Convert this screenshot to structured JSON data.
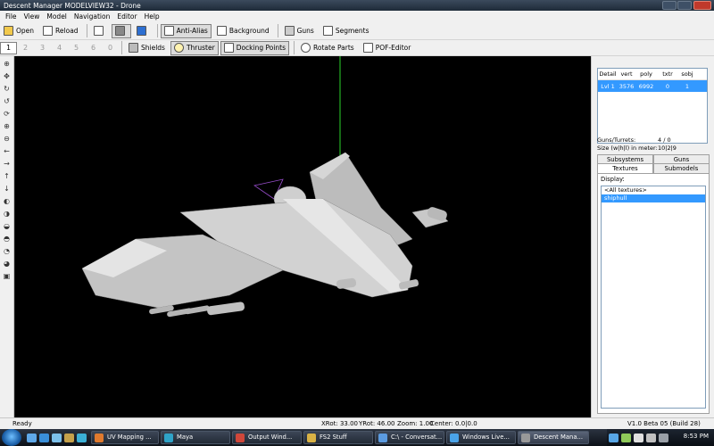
{
  "window": {
    "title": "Descent Manager MODELVIEW32 - Drone"
  },
  "menu": [
    "File",
    "View",
    "Model",
    "Navigation",
    "Editor",
    "Help"
  ],
  "toolbar1": {
    "open": "Open",
    "reload": "Reload",
    "anti_alias": "Anti-Alias",
    "background": "Background",
    "guns": "Guns",
    "segments": "Segments"
  },
  "toolbar2": {
    "numbers": [
      "1",
      "2",
      "3",
      "4",
      "5",
      "6",
      "0"
    ],
    "shields": "Shields",
    "thruster": "Thruster",
    "docking_points": "Docking Points",
    "rotate_parts": "Rotate Parts",
    "pof_editor": "POF-Editor"
  },
  "lod_table": {
    "headers": [
      "Detail",
      "vert",
      "poly",
      "txtr",
      "sobj"
    ],
    "rows": [
      [
        "Lvl 1",
        "3576",
        "6992",
        "0",
        "1"
      ]
    ]
  },
  "info": {
    "guns_turrets_label": "Guns/Turrets:",
    "guns_turrets_value": "4 / 0",
    "size_label": "Size (w|h|l) in meter:",
    "size_value": "10|2|9"
  },
  "tabs": {
    "subsystems": "Subsystems",
    "guns": "Guns",
    "textures": "Textures",
    "submodels": "Submodels"
  },
  "textures_panel": {
    "display_label": "Display:",
    "items": [
      "<All textures>",
      "shiphull"
    ]
  },
  "status": {
    "ready": "Ready",
    "xrot": "XRot: 33.00",
    "yrot": "YRot: 46.00",
    "zoom": "Zoom: 1.00",
    "center": "Center: 0.0|0.0",
    "version": "V1.0 Beta 05 (Build 28)"
  },
  "taskbar": {
    "tasks": [
      "UV Mapping ...",
      "Maya",
      "Output Wind...",
      "FS2 Stuff",
      "C:\\ - Conversat...",
      "Windows Live...",
      "Descent Mana..."
    ],
    "clock": "8:53 PM"
  },
  "colors": {
    "selection": "#3399ff",
    "viewport": "#000000"
  }
}
